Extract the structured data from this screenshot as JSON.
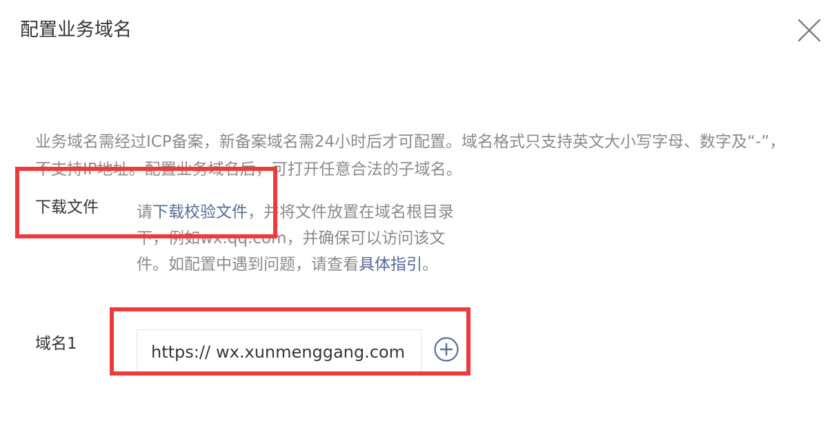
{
  "dialog": {
    "title": "配置业务域名"
  },
  "description": "业务域名需经过ICP备案，新备案域名需24小时后才可配置。域名格式只支持英文大小写字母、数字及“-”，不支持IP地址。配置业务域名后，可打开任意合法的子域名。",
  "download": {
    "label": "下载文件",
    "text_1": "请",
    "link_1": "下载校验文件",
    "text_2": "，并将文件放置在域名根目录下，例如wx.qq.com，并确保可以访问该文件。如配置中遇到问题，请查看",
    "link_2": "具体指引",
    "text_3": "。"
  },
  "domain": {
    "label": "域名1",
    "prefix": "https://",
    "value": "wx.xunmenggang.com"
  },
  "colors": {
    "link": "#576b95",
    "highlight": "#ee3a3c",
    "muted_text": "#8a8a8a"
  }
}
